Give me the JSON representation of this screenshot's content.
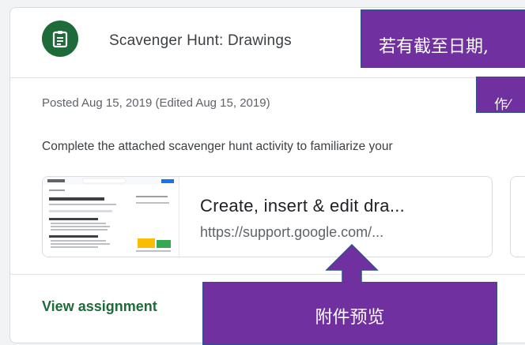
{
  "post": {
    "title": "Scavenger Hunt: Drawings",
    "icon": "assignment-icon",
    "posted": "Posted Aug 15, 2019 (Edited Aug 15, 2019)",
    "description": "Complete the attached scavenger hunt activity to familiarize your",
    "view_label": "View assignment"
  },
  "attachment": {
    "title": "Create, insert & edit dra...",
    "url": "https://support.google.com/...",
    "thumbnail": {
      "search_placeholder": "Search the Help Center",
      "heading": "Create, insert & edit drawings",
      "section1": "Create a drawing in Google Docs",
      "section2": "Insert a drawing in Google Docs"
    }
  },
  "annotations": {
    "top": "若有截至日期,",
    "middle": "作⁄",
    "bottom": "附件预览"
  },
  "colors": {
    "accent_green": "#1e6b3a",
    "callout_purple": "#7030a0"
  }
}
